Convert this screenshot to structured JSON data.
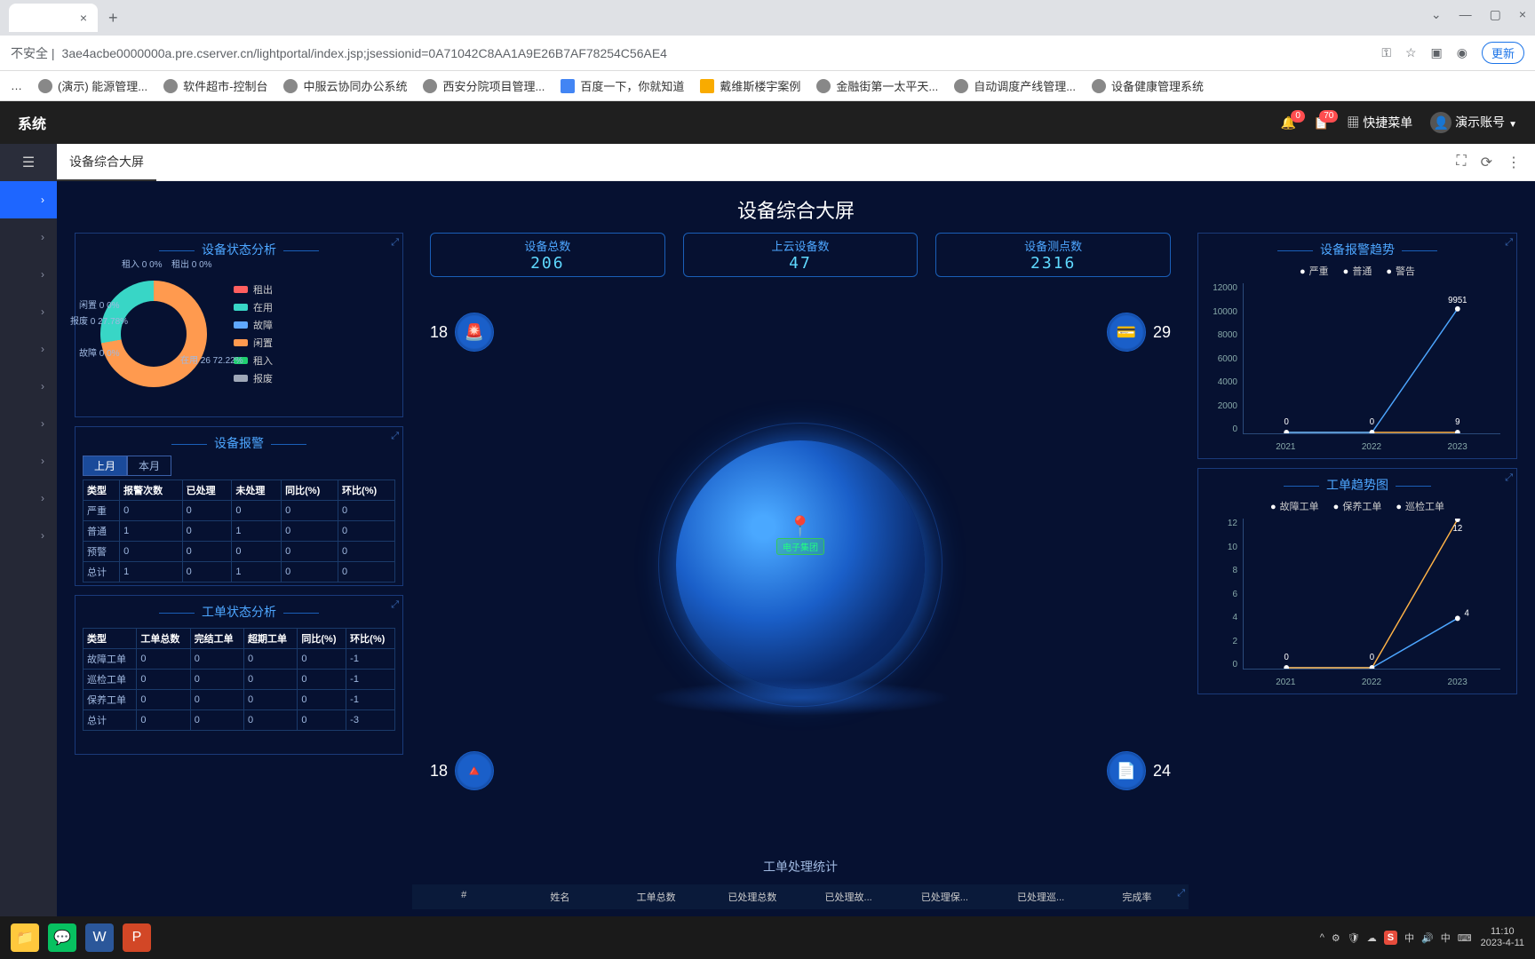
{
  "browser": {
    "address_prefix": "不安全 | ",
    "url": "3ae4acbe0000000a.pre.cserver.cn/lightportal/index.jsp;jsessionid=0A71042C8AA1A9E26B7AF78254C56AE4",
    "update_label": "更新",
    "bookmarks": [
      "(演示) 能源管理...",
      "软件超市-控制台",
      "中服云协同办公系统",
      "西安分院项目管理...",
      "百度一下，你就知道",
      "戴维斯楼宇案例",
      "金融街第一太平天...",
      "自动调度产线管理...",
      "设备健康管理系统"
    ]
  },
  "header": {
    "app_title": "系统",
    "badge_bell": "0",
    "badge_clip": "70",
    "quick_menu": "快捷菜单",
    "user_name": "演示账号"
  },
  "subheader": {
    "tab_label": "设备综合大屏"
  },
  "dashboard": {
    "title": "设备综合大屏",
    "stats": {
      "total": {
        "label": "设备总数",
        "value": "206"
      },
      "cloud": {
        "label": "上云设备数",
        "value": "47"
      },
      "points": {
        "label": "设备测点数",
        "value": "2316"
      }
    },
    "side_stats": {
      "tl": "18",
      "bl": "18",
      "tr": "29",
      "br": "24"
    },
    "globe_marker": "电子集团",
    "status": {
      "title": "设备状态分析",
      "labels": {
        "rent_in": "租入\n0\n0%",
        "rent_out": "租出\n0\n0%",
        "idle": "闲置\n0\n0%",
        "scrap": "报废\n0\n27.78%",
        "fault": "故障\n0\n0%",
        "inuse": "在用\n26\n72.22%"
      },
      "legend": [
        "租出",
        "在用",
        "故障",
        "闲置",
        "租入",
        "报废"
      ],
      "colors": [
        "#ff5f5f",
        "#38d6c6",
        "#5fa8ff",
        "#ff9a4f",
        "#20d070",
        "#9fa8b8"
      ]
    },
    "alarm": {
      "title": "设备报警",
      "tabs": [
        "上月",
        "本月"
      ],
      "headers": [
        "类型",
        "报警次数",
        "已处理",
        "未处理",
        "同比(%)",
        "环比(%)"
      ],
      "rows": [
        [
          "严重",
          "0",
          "0",
          "0",
          "0",
          "0"
        ],
        [
          "普通",
          "1",
          "0",
          "1",
          "0",
          "0"
        ],
        [
          "预警",
          "0",
          "0",
          "0",
          "0",
          "0"
        ],
        [
          "总计",
          "1",
          "0",
          "1",
          "0",
          "0"
        ]
      ]
    },
    "wo_status": {
      "title": "工单状态分析",
      "headers": [
        "类型",
        "工单总数",
        "完结工单",
        "超期工单",
        "同比(%)",
        "环比(%)"
      ],
      "rows": [
        [
          "故障工单",
          "0",
          "0",
          "0",
          "0",
          "-1"
        ],
        [
          "巡检工单",
          "0",
          "0",
          "0",
          "0",
          "-1"
        ],
        [
          "保养工单",
          "0",
          "0",
          "0",
          "0",
          "-1"
        ],
        [
          "总计",
          "0",
          "0",
          "0",
          "0",
          "-3"
        ]
      ]
    },
    "wo_proc": {
      "title": "工单处理统计",
      "headers": [
        "#",
        "姓名",
        "工单总数",
        "已处理总数",
        "已处理故...",
        "已处理保...",
        "已处理巡...",
        "完成率"
      ]
    }
  },
  "chart_data": [
    {
      "type": "line",
      "title": "设备报警趋势",
      "legend": [
        "严重",
        "普通",
        "警告"
      ],
      "categories": [
        "2021",
        "2022",
        "2023"
      ],
      "series": [
        {
          "name": "严重",
          "values": [
            0,
            0,
            9
          ]
        },
        {
          "name": "普通",
          "values": [
            0,
            0,
            0
          ]
        },
        {
          "name": "警告",
          "values": [
            0,
            0,
            9951
          ]
        }
      ],
      "ylim": [
        0,
        12000
      ],
      "yticks": [
        0,
        2000,
        4000,
        6000,
        8000,
        10000,
        12000
      ]
    },
    {
      "type": "line",
      "title": "工单趋势图",
      "legend": [
        "故障工单",
        "保养工单",
        "巡检工单"
      ],
      "categories": [
        "2021",
        "2022",
        "2023"
      ],
      "series": [
        {
          "name": "故障工单",
          "values": [
            0,
            0,
            4
          ]
        },
        {
          "name": "保养工单",
          "values": [
            0,
            0,
            0
          ]
        },
        {
          "name": "巡检工单",
          "values": [
            0,
            0,
            12
          ]
        }
      ],
      "ylim": [
        0,
        12
      ],
      "yticks": [
        0,
        2,
        4,
        6,
        8,
        10,
        12
      ]
    }
  ],
  "taskbar": {
    "time": "11:10",
    "date": "2023-4-11",
    "lang": "中"
  }
}
